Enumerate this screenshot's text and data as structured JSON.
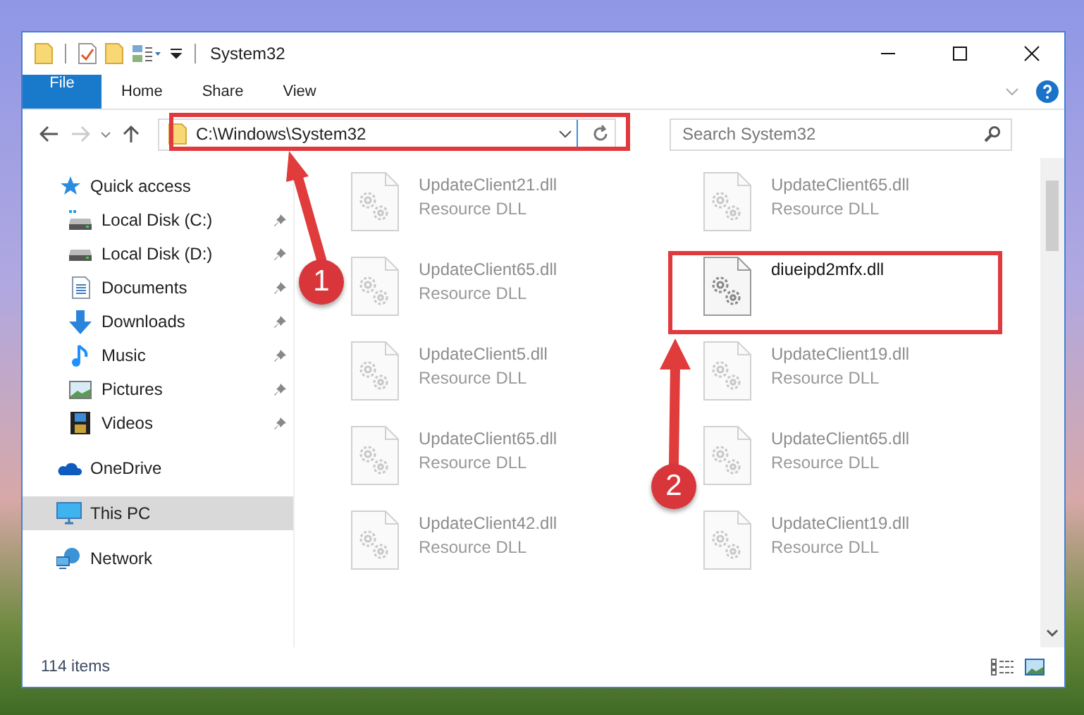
{
  "window": {
    "title": "System32"
  },
  "ribbon_tabs": [
    {
      "label": "File",
      "kind": "file"
    },
    {
      "label": "Home",
      "kind": "tab"
    },
    {
      "label": "Share",
      "kind": "tab"
    },
    {
      "label": "View",
      "kind": "tab"
    }
  ],
  "address_bar": {
    "path": "C:\\Windows\\System32"
  },
  "search": {
    "placeholder": "Search System32"
  },
  "sidebar": {
    "items": [
      {
        "label": "Quick access",
        "selected": false,
        "children": [
          {
            "label": "Local Disk (C:)",
            "selected": false,
            "pinned": true
          },
          {
            "label": "Local Disk (D:)",
            "selected": false,
            "pinned": true
          },
          {
            "label": "Documents",
            "selected": false,
            "pinned": true
          },
          {
            "label": "Downloads",
            "selected": false,
            "pinned": true
          },
          {
            "label": "Music",
            "selected": false,
            "pinned": true
          },
          {
            "label": "Pictures",
            "selected": false,
            "pinned": true
          },
          {
            "label": "Videos",
            "selected": false,
            "pinned": true
          }
        ]
      },
      {
        "label": "OneDrive",
        "selected": false
      },
      {
        "label": "This PC",
        "selected": true
      },
      {
        "label": "Network",
        "selected": false
      }
    ]
  },
  "files": [
    {
      "name": "UpdateClient21.dll",
      "type": "Resource DLL",
      "blurred": true
    },
    {
      "name": "UpdateClient65.dll",
      "type": "Resource DLL",
      "blurred": true
    },
    {
      "name": "UpdateClient65.dll",
      "type": "Resource DLL",
      "blurred": true
    },
    {
      "name": "diueipd2mfx.dll",
      "blurred": false
    },
    {
      "name": "UpdateClient5.dll",
      "type": "Resource DLL",
      "blurred": true
    },
    {
      "name": "UpdateClient19.dll",
      "type": "Resource DLL",
      "blurred": true
    },
    {
      "name": "UpdateClient65.dll",
      "type": "Resource DLL",
      "blurred": true
    },
    {
      "name": "UpdateClient65.dll",
      "type": "Resource DLL",
      "blurred": true
    },
    {
      "name": "UpdateClient42.dll",
      "type": "Resource DLL",
      "blurred": true
    },
    {
      "name": "UpdateClient19.dll",
      "type": "Resource DLL",
      "blurred": true
    }
  ],
  "status_bar": {
    "item_count": "114 items"
  },
  "annotations": [
    {
      "label": "1"
    },
    {
      "label": "2"
    }
  ]
}
